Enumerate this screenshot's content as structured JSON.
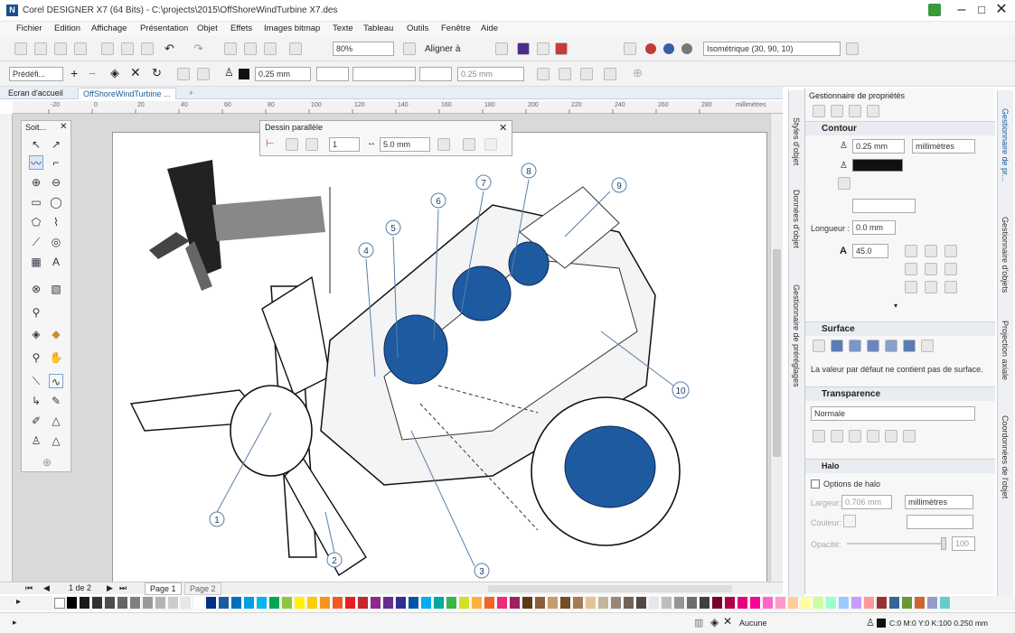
{
  "window": {
    "title": "Corel DESIGNER X7 (64 Bits) - C:\\projects\\2015\\OffShoreWindTurbine X7.des",
    "app_icon": "N"
  },
  "menu": [
    "Fichier",
    "Edition",
    "Affichage",
    "Présentation",
    "Objet",
    "Effets",
    "Images bitmap",
    "Texte",
    "Tableau",
    "Outils",
    "Fenêtre",
    "Aide"
  ],
  "toolbar1": {
    "zoom": "80%",
    "align_label": "Aligner à",
    "view_select": "Isométrique (30, 90, 10)"
  },
  "toolbar2": {
    "preset": "Prédéfi...",
    "outline_width": "0.25 mm",
    "arrow_width": "0.25 mm"
  },
  "doc_tabs": {
    "home": "Ecran d'accueil",
    "active": "OffShoreWindTurbine ...",
    "add": "+"
  },
  "ruler": {
    "unit": "millimètres",
    "ticks": [
      "-20",
      "0",
      "20",
      "40",
      "60",
      "80",
      "100",
      "120",
      "140",
      "160",
      "180",
      "200",
      "220",
      "240",
      "260",
      "280"
    ]
  },
  "toolbox": {
    "title": "Soit...",
    "close": "✕"
  },
  "parallel_dialog": {
    "title": "Dessin parallèle",
    "count": "1",
    "distance": "5.0 mm",
    "close": "✕"
  },
  "callouts": [
    "1",
    "2",
    "3",
    "4",
    "5",
    "6",
    "7",
    "8",
    "9",
    "10"
  ],
  "page_nav": {
    "current": "1 de 2",
    "tabs": [
      "Page 1",
      "Page 2"
    ]
  },
  "properties": {
    "title": "Gestionnaire de propriétés",
    "contour": {
      "label": "Contour",
      "width": "0.25 mm",
      "unit": "millimètres",
      "length_label": "Longueur :",
      "length": "0.0 mm",
      "angle": "45.0"
    },
    "surface": {
      "label": "Surface",
      "note": "La valeur par défaut ne contient pas de surface."
    },
    "transparence": {
      "label": "Transparence",
      "mode": "Normale"
    },
    "halo": {
      "label": "Halo",
      "options_label": "Options de halo",
      "width_label": "Largeur:",
      "width": "0.706 mm",
      "unit": "millimètres",
      "color_label": "Couleur:",
      "opacity_label": "Opacité:",
      "opacity": "100"
    }
  },
  "side_tabs_left": [
    "Styles d'objet",
    "Données d'objet",
    "Gestionnaire de préréglages"
  ],
  "side_tabs_right": [
    "Gestionnaire de pr...",
    "Gestionnaire d'objets",
    "Projection axiale",
    "Coordonnées de l'objet"
  ],
  "status": {
    "fill_label": "Aucune",
    "outline_info": "C:0 M:0 Y:0 K:100 0.250 mm"
  },
  "colors": {
    "accent": "#1b5a9c",
    "model_blue": "#1e5aa0",
    "tab_active": "#2b6bbf"
  },
  "icons": [
    "search-icon",
    "gear-icon",
    "close-icon",
    "eyedropper-icon",
    "zoom-icon"
  ]
}
